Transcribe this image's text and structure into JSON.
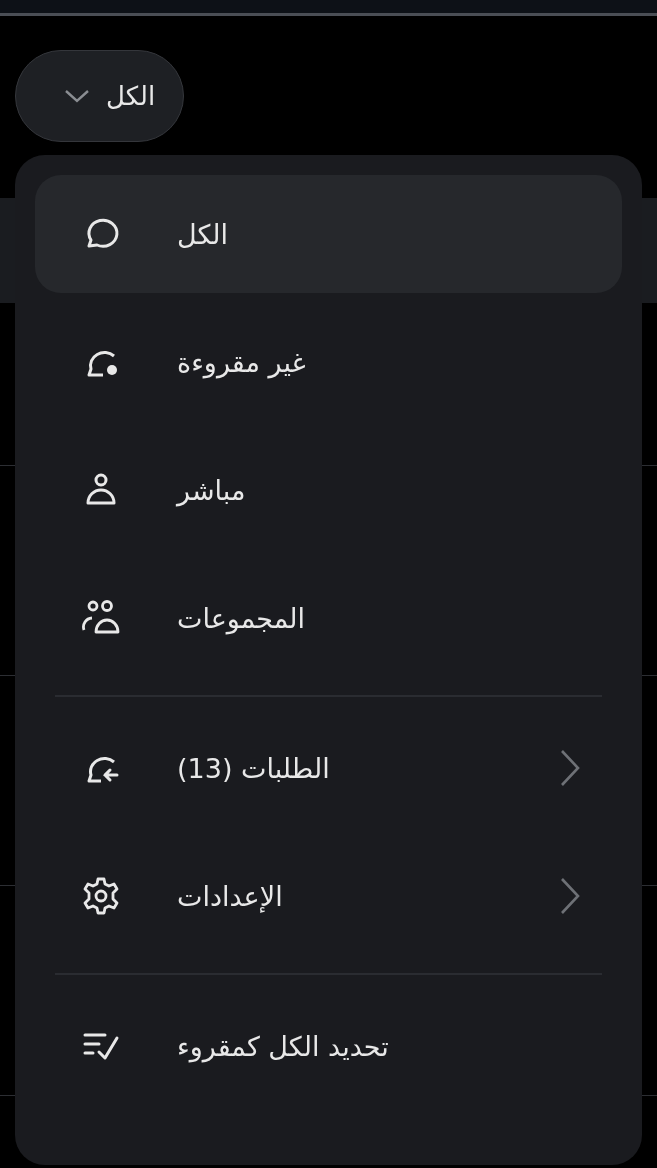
{
  "header": {
    "filter_button": {
      "label": "الكل"
    }
  },
  "menu": {
    "groups": [
      [
        {
          "label": "الكل",
          "selected": true,
          "submenu": false
        },
        {
          "label": "غير مقروءة",
          "selected": false,
          "submenu": false
        },
        {
          "label": "مباشر",
          "selected": false,
          "submenu": false
        },
        {
          "label": "المجموعات",
          "selected": false,
          "submenu": false
        }
      ],
      [
        {
          "label": "الطلبات (13)",
          "selected": false,
          "submenu": true
        },
        {
          "label": "الإعدادات",
          "selected": false,
          "submenu": true
        }
      ],
      [
        {
          "label": "تحديد الكل كمقروء",
          "selected": false,
          "submenu": false
        }
      ]
    ]
  }
}
